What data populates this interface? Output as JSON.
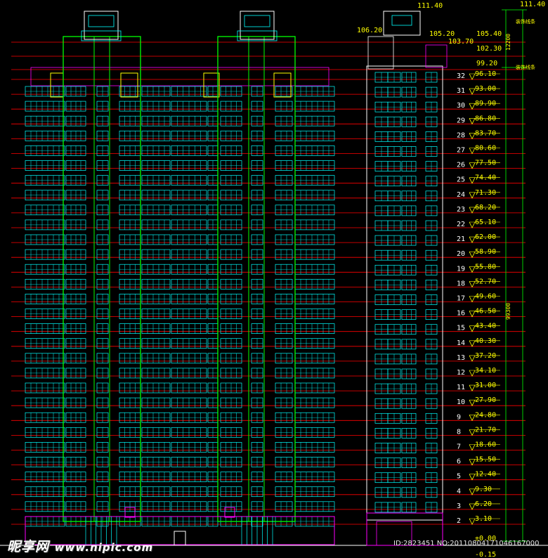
{
  "elevation": {
    "floors": [
      "2",
      "3",
      "4",
      "5",
      "6",
      "7",
      "8",
      "9",
      "10",
      "11",
      "12",
      "13",
      "14",
      "15",
      "16",
      "17",
      "18",
      "19",
      "20",
      "21",
      "22",
      "23",
      "24",
      "25",
      "26",
      "27",
      "28",
      "29",
      "30",
      "31",
      "32"
    ],
    "floor_levels": [
      "3.10",
      "6.20",
      "9.30",
      "12.40",
      "15.50",
      "18.60",
      "21.70",
      "24.80",
      "27.90",
      "31.00",
      "34.10",
      "37.20",
      "40.30",
      "43.40",
      "46.50",
      "49.60",
      "52.70",
      "55.80",
      "58.90",
      "62.00",
      "65.10",
      "68.20",
      "71.30",
      "74.40",
      "77.50",
      "80.60",
      "83.70",
      "86.80",
      "89.90",
      "93.00",
      "96.10"
    ],
    "top_levels": {
      "parapet": "99.20",
      "roof": "102.30",
      "roof_upper": "105.40",
      "stair_roof": "105.20",
      "machine_room": "103.70",
      "left_tower": "106.20",
      "top": "111.40",
      "top_right": "111.40"
    },
    "ground_level": "±0.00",
    "below_ground": "-0.15",
    "dim_total": "99300",
    "dim_top": "12200",
    "notes": [
      "装饰线条",
      "装饰线条"
    ],
    "colors": {
      "background": "#000000",
      "level_line": "#ff0000",
      "facade": "#00ffff",
      "column": "#00ff00",
      "accent": "#ff00ff",
      "highlight": "#ffff00",
      "text": "#ffffff"
    }
  },
  "watermark": {
    "logo": "昵享网",
    "url": "www.nipic.com",
    "id_line": "ID:2823451 NO:20110804171046167000"
  }
}
